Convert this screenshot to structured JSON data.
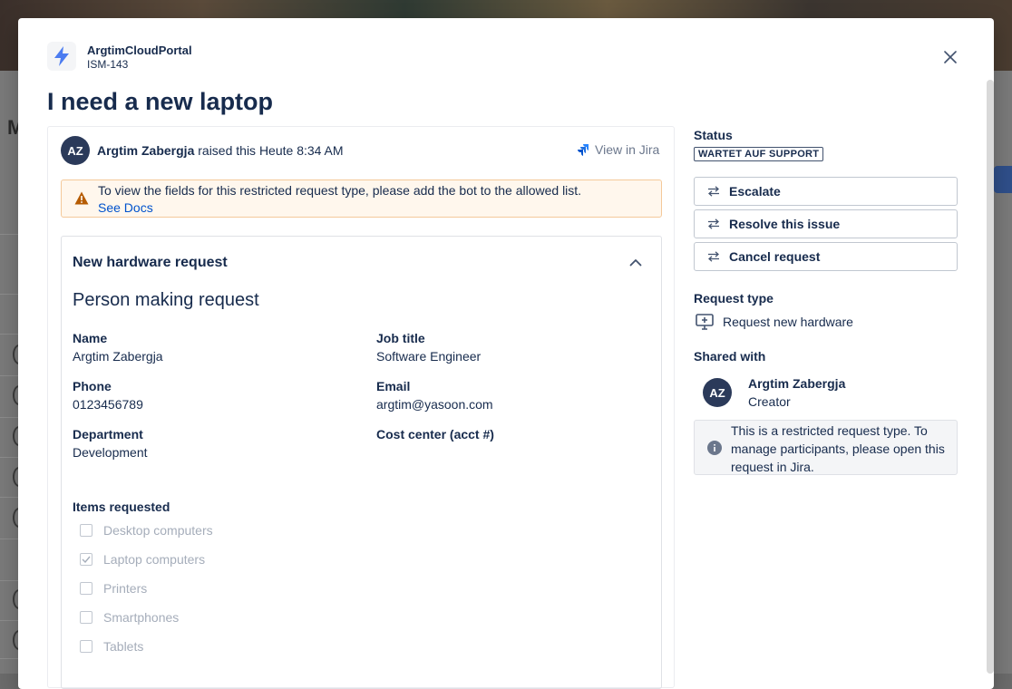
{
  "modal": {
    "portal_name": "ArgtimCloudPortal",
    "issue_key": "ISM-143",
    "title": "I need a new laptop",
    "close_icon": "close-icon"
  },
  "activity": {
    "avatar_initials": "AZ",
    "reporter": "Argtim Zabergja",
    "raised_text": " raised this Heute 8:34 AM",
    "view_in_jira": "View in Jira"
  },
  "warning": {
    "text": "To view the fields for this restricted request type, please add the bot to the allowed list.",
    "link": "See Docs",
    "color": "#fff7ed"
  },
  "form": {
    "title": "New hardware request",
    "section_title": "Person making request",
    "fields": {
      "name": {
        "label": "Name",
        "value": "Argtim Zabergja"
      },
      "job_title": {
        "label": "Job title",
        "value": "Software Engineer"
      },
      "phone": {
        "label": "Phone",
        "value": "0123456789"
      },
      "email": {
        "label": "Email",
        "value": "argtim@yasoon.com"
      },
      "department": {
        "label": "Department",
        "value": "Development"
      },
      "cost_center": {
        "label": "Cost center (acct #)",
        "value": ""
      }
    },
    "items_label": "Items requested",
    "items": [
      {
        "label": "Desktop computers",
        "checked": false
      },
      {
        "label": "Laptop computers",
        "checked": true
      },
      {
        "label": "Printers",
        "checked": false
      },
      {
        "label": "Smartphones",
        "checked": false
      },
      {
        "label": "Tablets",
        "checked": false
      }
    ]
  },
  "sidebar": {
    "status_label": "Status",
    "status_value": "WARTET AUF SUPPORT",
    "actions": [
      "Escalate",
      "Resolve this issue",
      "Cancel request"
    ],
    "request_type_label": "Request type",
    "request_type_value": "Request new hardware",
    "shared_with_label": "Shared with",
    "shared_user": {
      "initials": "AZ",
      "name": "Argtim Zabergja",
      "role": "Creator"
    },
    "info_text": "This is a restricted request type. To manage participants, please open this request in Jira."
  },
  "colors": {
    "primary_text": "#172b4d",
    "link": "#0052cc",
    "avatar_bg": "#2b3a5a"
  }
}
